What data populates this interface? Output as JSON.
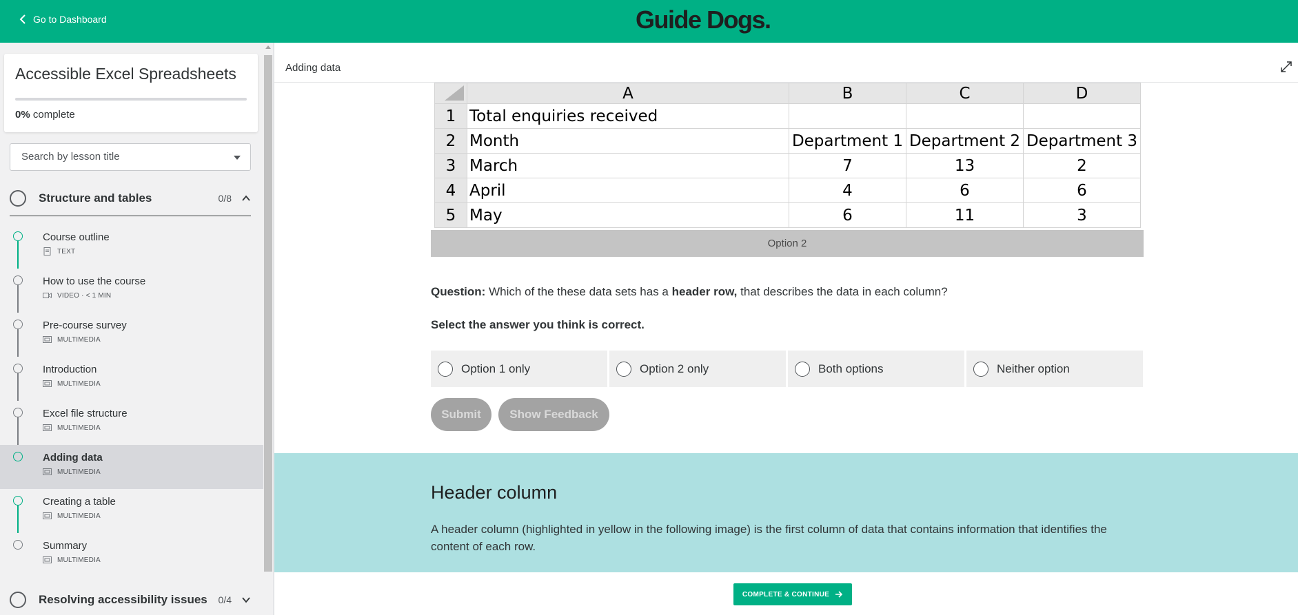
{
  "topbar": {
    "back_label": "Go to Dashboard",
    "brand": "Guide Dogs.",
    "color": "#00b085"
  },
  "sidebar": {
    "course_title": "Accessible Excel Spreadsheets",
    "progress_percent": "0%",
    "progress_label": "complete",
    "progress_value": 0,
    "search_placeholder": "Search by lesson title",
    "sections": [
      {
        "title": "Structure and tables",
        "count": "0/8",
        "expanded": true
      },
      {
        "title": "Resolving accessibility issues",
        "count": "0/4",
        "expanded": false
      }
    ],
    "lessons": [
      {
        "name": "Course outline",
        "type": "TEXT",
        "icon": "document-icon"
      },
      {
        "name": "How to use the course",
        "type": "VIDEO · < 1 MIN",
        "icon": "video-icon"
      },
      {
        "name": "Pre-course survey",
        "type": "MULTIMEDIA",
        "icon": "multimedia-icon"
      },
      {
        "name": "Introduction",
        "type": "MULTIMEDIA",
        "icon": "multimedia-icon"
      },
      {
        "name": "Excel file structure",
        "type": "MULTIMEDIA",
        "icon": "multimedia-icon"
      },
      {
        "name": "Adding data",
        "type": "MULTIMEDIA",
        "icon": "multimedia-icon"
      },
      {
        "name": "Creating a table",
        "type": "MULTIMEDIA",
        "icon": "multimedia-icon"
      },
      {
        "name": "Summary",
        "type": "MULTIMEDIA",
        "icon": "multimedia-icon"
      }
    ]
  },
  "main": {
    "page_title": "Adding data",
    "spreadsheet": {
      "columns": [
        "A",
        "B",
        "C",
        "D"
      ],
      "rows": [
        {
          "n": "1",
          "cells": [
            "Total enquiries received",
            "",
            "",
            ""
          ]
        },
        {
          "n": "2",
          "cells": [
            "Month",
            "Department 1",
            "Department 2",
            "Department 3"
          ]
        },
        {
          "n": "3",
          "cells": [
            "March",
            "7",
            "13",
            "2"
          ]
        },
        {
          "n": "4",
          "cells": [
            "April",
            "4",
            "6",
            "6"
          ]
        },
        {
          "n": "5",
          "cells": [
            "May",
            "6",
            "11",
            "3"
          ]
        }
      ],
      "caption": "Option 2"
    },
    "question": {
      "label": "Question:",
      "text_before": " Which of the these data sets has a ",
      "emphasis": "header row,",
      "text_after": " that describes the data in each column?",
      "instruction": "Select the answer you think is correct.",
      "options": [
        "Option 1 only",
        "Option 2 only",
        "Both options",
        "Neither option"
      ],
      "submit_label": "Submit",
      "feedback_label": "Show Feedback"
    },
    "header_column": {
      "title": "Header column",
      "description": "A header column (highlighted in yellow in the following image) is the first column of data that contains information that identifies the content of each row."
    },
    "continue_label": "COMPLETE & CONTINUE"
  }
}
